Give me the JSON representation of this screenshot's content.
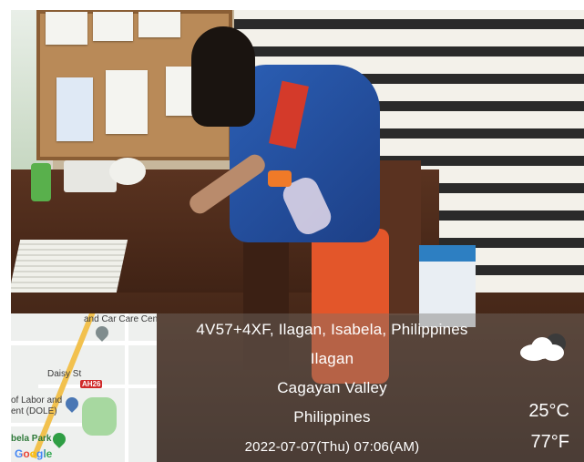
{
  "overlay": {
    "plus_code": "4V57+4XF, Ilagan, Isabela, Philippines",
    "city": "Ilagan",
    "region": "Cagayan Valley",
    "country": "Philippines",
    "timestamp": "2022-07-07(Thu)  07:06(AM)",
    "temp_c": "25°C",
    "temp_f": "77°F",
    "weather_icon": "partly-cloudy-icon"
  },
  "map": {
    "label_car_care": "and Car Care Cen",
    "label_daisy": "Daisy St",
    "highway_badge": "AH26",
    "label_dole_1": "of Labor and",
    "label_dole_2": "ent (DOLE)",
    "label_park": "bela Park",
    "logo": "Google",
    "colors": {
      "road": "#ffffff",
      "highway": "#f2c14e",
      "park": "#a7d8a0",
      "pin_primary": "#4a77b4",
      "pin_park": "#2f9e44"
    }
  }
}
